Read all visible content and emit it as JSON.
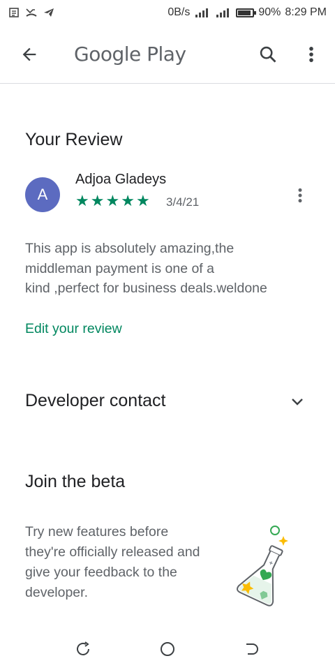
{
  "status_bar": {
    "network_speed": "0B/s",
    "battery_percent": "90%",
    "battery_level": 0.9,
    "time": "8:29 PM",
    "left_icons": [
      "notification-icon",
      "missed-call-icon",
      "telegram-icon"
    ]
  },
  "app_bar": {
    "title": "Google Play",
    "back_icon": "arrow-back-icon",
    "search_icon": "search-icon",
    "menu_icon": "more-vert-icon"
  },
  "your_review": {
    "title": "Your Review",
    "reviewer": {
      "avatar_letter": "A",
      "name": "Adjoa Gladeys",
      "rating": 5,
      "rating_max": 5,
      "date": "3/4/21"
    },
    "text_lines": [
      "This app is absolutely amazing,the",
      "middleman payment is one of a",
      "kind ,perfect for business deals.weldone"
    ],
    "edit_link": "Edit your review"
  },
  "developer_contact": {
    "label": "Developer contact",
    "icon": "chevron-down-icon"
  },
  "join_beta": {
    "title": "Join the beta",
    "text_lines": [
      "Try new features before",
      "they're officially released and",
      "give your feedback to the",
      "developer."
    ],
    "illustration": "beta-flask-illustration"
  },
  "nav": {
    "recents_icon": "recents-icon",
    "home_icon": "home-icon",
    "back_icon": "nav-back-icon"
  },
  "colors": {
    "accent": "#01875f",
    "avatar": "#5c6bc0",
    "text_primary": "#202124",
    "text_secondary": "#5f6368"
  }
}
